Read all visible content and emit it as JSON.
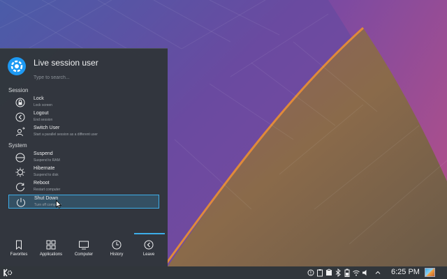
{
  "launcher": {
    "username": "Live session user",
    "search_placeholder": "Type to search...",
    "sections": {
      "session": "Session",
      "system": "System"
    },
    "items": [
      {
        "title": "Lock",
        "subtitle": "Lock screen",
        "icon": "lock-icon"
      },
      {
        "title": "Logout",
        "subtitle": "End session",
        "icon": "logout-icon"
      },
      {
        "title": "Switch User",
        "subtitle": "Start a parallel session as a different user",
        "icon": "switch-user-icon"
      },
      {
        "title": "Suspend",
        "subtitle": "Suspend to RAM",
        "icon": "suspend-icon"
      },
      {
        "title": "Hibernate",
        "subtitle": "Suspend to disk",
        "icon": "hibernate-icon"
      },
      {
        "title": "Reboot",
        "subtitle": "Restart computer",
        "icon": "reboot-icon"
      },
      {
        "title": "Shut Down",
        "subtitle": "Turn off computer",
        "icon": "shutdown-icon",
        "selected": true
      }
    ],
    "tabs": [
      {
        "label": "Favorites",
        "icon": "bookmark-icon"
      },
      {
        "label": "Applications",
        "icon": "grid-icon"
      },
      {
        "label": "Computer",
        "icon": "monitor-icon"
      },
      {
        "label": "History",
        "icon": "clock-icon"
      },
      {
        "label": "Leave",
        "icon": "leave-icon",
        "active": true
      }
    ]
  },
  "taskbar": {
    "clock": "6:25 PM",
    "tray_icons": [
      "notification-icon",
      "clipboard-icon",
      "package-icon",
      "bluetooth-icon",
      "battery-icon",
      "network-icon",
      "volume-icon",
      "expand-icon"
    ]
  },
  "colors": {
    "accent": "#3daee9",
    "panel": "#31363b"
  }
}
